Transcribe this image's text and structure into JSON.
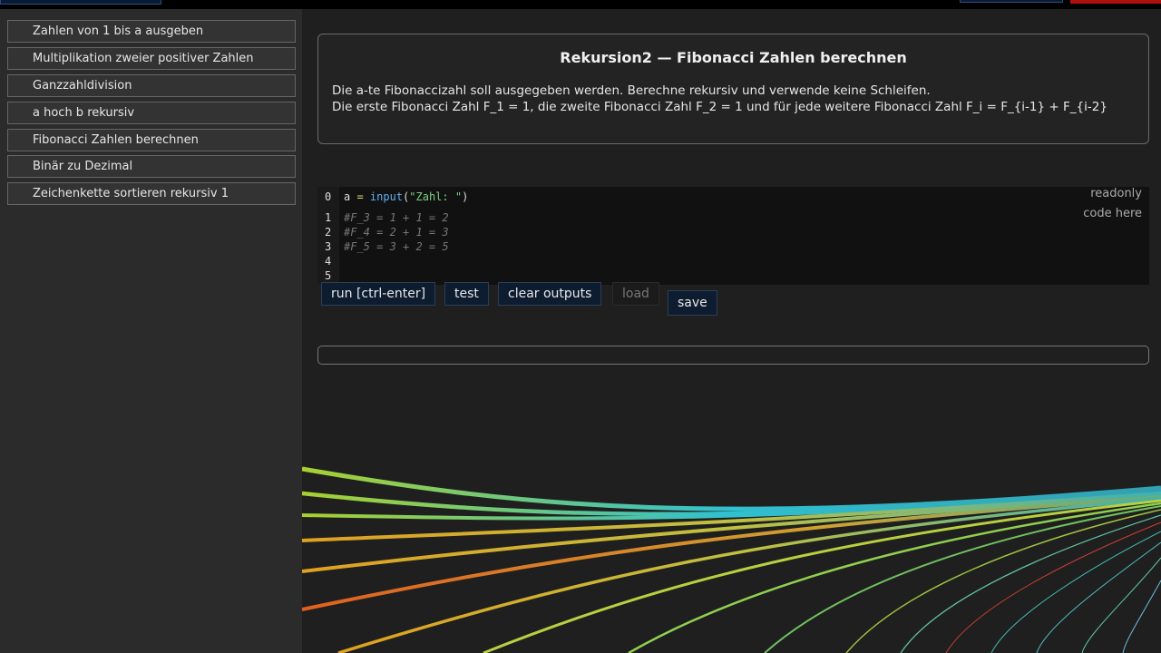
{
  "sidebar": {
    "items": [
      {
        "label": "Zahlen von 1 bis a ausgeben"
      },
      {
        "label": "Multiplikation zweier positiver Zahlen"
      },
      {
        "label": "Ganzzahldivision"
      },
      {
        "label": "a hoch b rekursiv"
      },
      {
        "label": "Fibonacci Zahlen berechnen"
      },
      {
        "label": "Binär zu Dezimal"
      },
      {
        "label": "Zeichenkette sortieren rekursiv 1"
      }
    ]
  },
  "task": {
    "title": "Rekursion2 — Fibonacci Zahlen berechnen",
    "line1": "Die a-te Fibonaccizahl soll ausgegeben werden. Berechne rekursiv und verwende keine Schleifen.",
    "line2": "Die erste Fibonacci Zahl F_1 = 1, die zweite Fibonacci Zahl F_2 = 1 und für jede weitere Fibonacci Zahl F_i = F_{i-1} + F_{i-2}"
  },
  "editor": {
    "readonly_label": "readonly",
    "hint_label": "code here",
    "line_numbers": [
      "0",
      "1",
      "2",
      "3",
      "4",
      "5"
    ],
    "line0": {
      "var": "a",
      "op": " = ",
      "fn": "input",
      "open": "(",
      "str": "\"Zahl: \"",
      "close": ")"
    },
    "comments": [
      "#F_3 = 1 + 1 = 2",
      "#F_4 = 2 + 1 = 3",
      "#F_5 = 3 + 2 = 5"
    ]
  },
  "toolbar": {
    "run_label": "run [ctrl-enter]",
    "test_label": "test",
    "clear_label": "clear outputs",
    "load_label": "load",
    "save_label": "save"
  },
  "output": {
    "text": ""
  },
  "colors": {
    "background": "#1f1f1f",
    "sidebar": "#2b2b2b",
    "button": "#0e1c30",
    "accent_red": "#b01010"
  }
}
